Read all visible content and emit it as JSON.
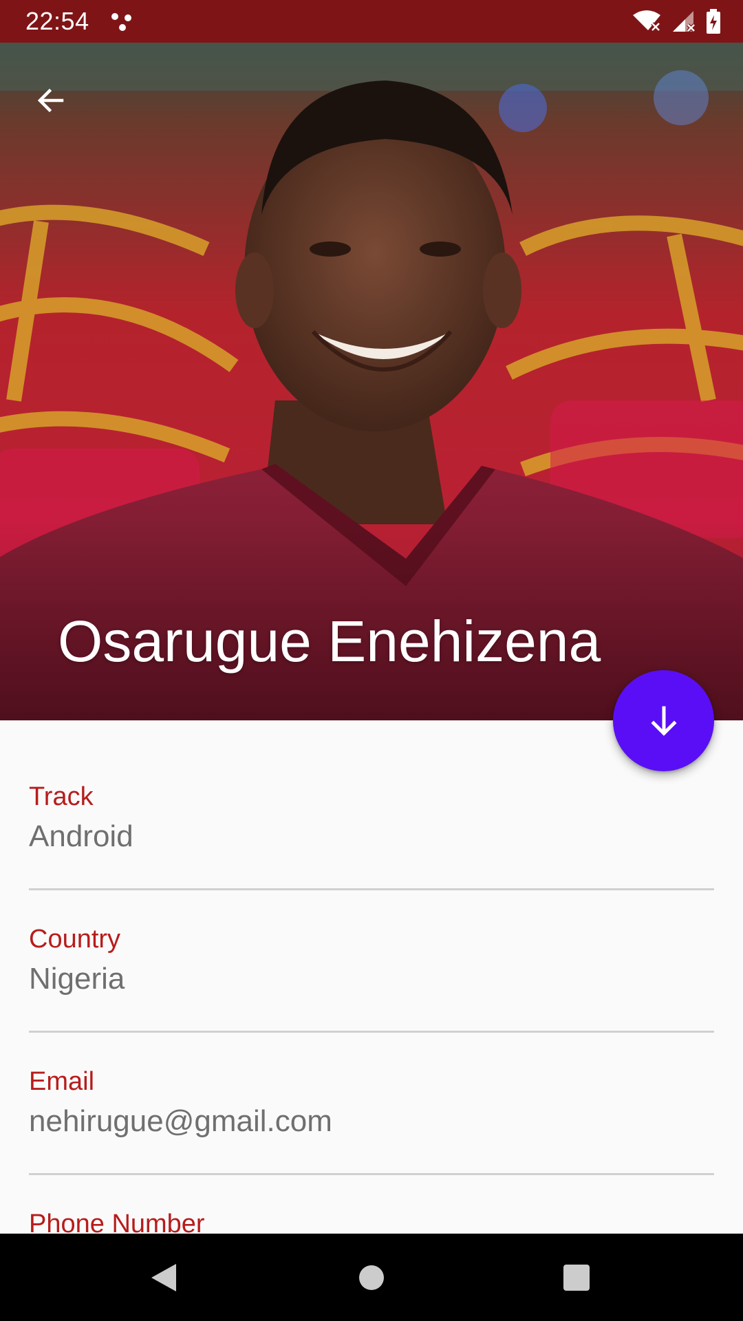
{
  "status_bar": {
    "time": "22:54",
    "icons": [
      "notification-dots-icon",
      "wifi-off-icon",
      "signal-off-icon",
      "battery-charging-icon"
    ],
    "background": "#7f1416"
  },
  "header": {
    "name": "Osarugue Enehizena",
    "back_icon": "arrow-back-icon"
  },
  "fab": {
    "icon": "arrow-down-icon",
    "color": "#5a0ef5"
  },
  "fields": [
    {
      "label": "Track",
      "value": "Android"
    },
    {
      "label": "Country",
      "value": "Nigeria"
    },
    {
      "label": "Email",
      "value": "nehirugue@gmail.com"
    },
    {
      "label": "Phone Number",
      "value": ""
    }
  ],
  "colors": {
    "label": "#b71c1c",
    "value": "#6f6f6f",
    "divider": "#d0d0d0"
  },
  "nav_bar": {
    "icons": [
      "back-triangle-icon",
      "home-circle-icon",
      "recents-square-icon"
    ]
  }
}
